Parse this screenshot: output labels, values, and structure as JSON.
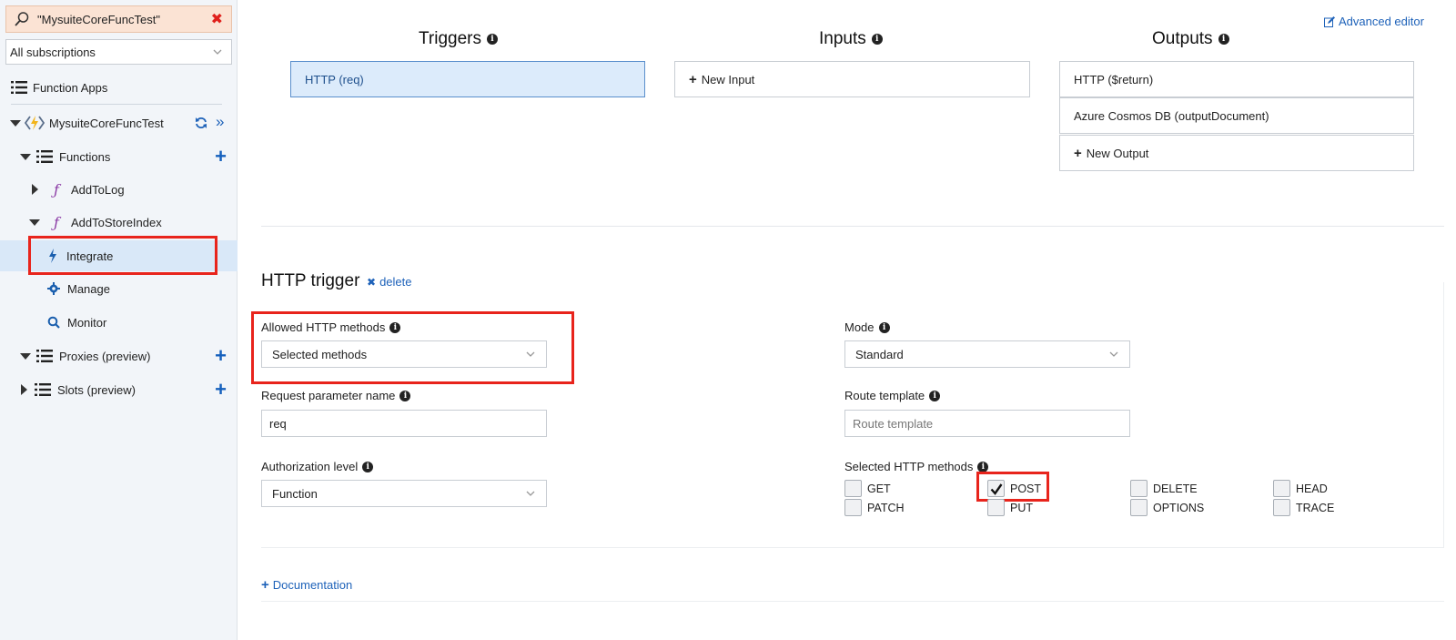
{
  "sidebar": {
    "search_value": "\"MysuiteCoreFuncTest\"",
    "subscription_selected": "All subscriptions",
    "function_apps_label": "Function Apps",
    "app_name": "MysuiteCoreFuncTest",
    "functions_label": "Functions",
    "items": {
      "add_to_log": "AddToLog",
      "add_to_store_index": "AddToStoreIndex",
      "integrate": "Integrate",
      "manage": "Manage",
      "monitor": "Monitor",
      "proxies": "Proxies (preview)",
      "slots": "Slots (preview)"
    }
  },
  "header": {
    "advanced_editor": "Advanced editor"
  },
  "bindings": {
    "triggers_title": "Triggers",
    "inputs_title": "Inputs",
    "outputs_title": "Outputs",
    "trigger_items": [
      "HTTP (req)"
    ],
    "new_input": "New Input",
    "output_items": [
      "HTTP ($return)",
      "Azure Cosmos DB (outputDocument)"
    ],
    "new_output": "New Output"
  },
  "trigger": {
    "title": "HTTP trigger",
    "delete_label": "delete",
    "allowed_methods_label": "Allowed HTTP methods",
    "allowed_methods_value": "Selected methods",
    "mode_label": "Mode",
    "mode_value": "Standard",
    "request_param_label": "Request parameter name",
    "request_param_value": "req",
    "route_template_label": "Route template",
    "route_template_placeholder": "Route template",
    "auth_level_label": "Authorization level",
    "auth_level_value": "Function",
    "selected_methods_label": "Selected HTTP methods",
    "methods": {
      "get": {
        "label": "GET",
        "checked": false
      },
      "post": {
        "label": "POST",
        "checked": true
      },
      "delete": {
        "label": "DELETE",
        "checked": false
      },
      "head": {
        "label": "HEAD",
        "checked": false
      },
      "patch": {
        "label": "PATCH",
        "checked": false
      },
      "put": {
        "label": "PUT",
        "checked": false
      },
      "options": {
        "label": "OPTIONS",
        "checked": false
      },
      "trace": {
        "label": "TRACE",
        "checked": false
      }
    }
  },
  "footer": {
    "documentation": "Documentation"
  },
  "colors": {
    "accent": "#1e62b9",
    "highlight": "#e8241c",
    "selected_row": "#d9e8f8"
  }
}
